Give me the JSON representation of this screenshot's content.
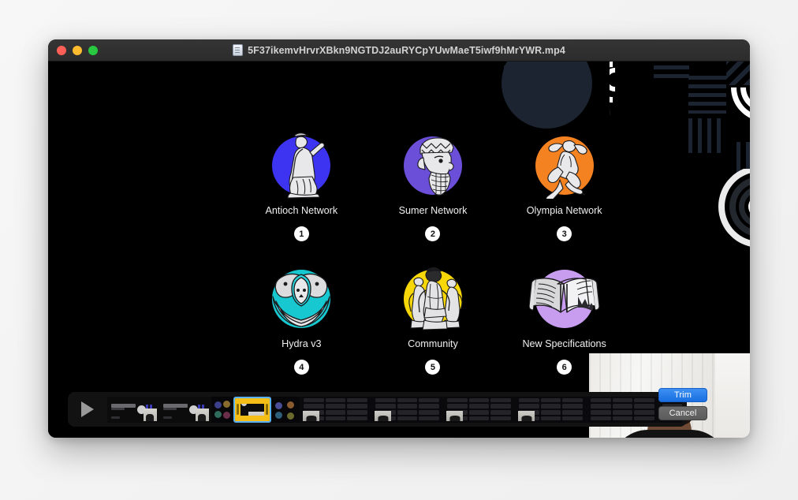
{
  "window": {
    "title": "5F37ikemvHrvrXBkn9NGTDJ2auRYCpYUwMaeT5iwf9hMrYWR.mp4",
    "doc_icon": "document-icon",
    "traffic_lights": [
      {
        "name": "close",
        "color": "#ff5f57"
      },
      {
        "name": "minimize",
        "color": "#febc2e"
      },
      {
        "name": "maximize",
        "color": "#28c840"
      }
    ]
  },
  "video_frame": {
    "background_color": "#000000",
    "apps": [
      {
        "label": "Antioch Network",
        "badge": "1",
        "blob_color": "#3d34f2",
        "icon": "roman-orator-statue-icon"
      },
      {
        "label": "Sumer Network",
        "badge": "2",
        "blob_color": "#6b4fd8",
        "icon": "sumerian-king-head-icon"
      },
      {
        "label": "Olympia Network",
        "badge": "3",
        "blob_color": "#f58220",
        "icon": "discus-thrower-icon"
      },
      {
        "label": "Hydra v3",
        "badge": "4",
        "blob_color": "#18c8d0",
        "icon": "hydra-shield-icon"
      },
      {
        "label": "Community",
        "badge": "5",
        "blob_color": "#f7d708",
        "icon": "greek-figures-group-icon"
      },
      {
        "label": "New Specifications",
        "badge": "6",
        "blob_color": "#c89df0",
        "icon": "open-book-icon"
      }
    ]
  },
  "webcam_overlay": {
    "name": "picture-in-picture-webcam",
    "description": "presenter in front of white curtains"
  },
  "controls": {
    "play_button_icon": "play-triangle-icon",
    "timeline_name": "video-timeline-scrubber",
    "trim_selection": {
      "name": "trim-range-selector",
      "handle_color": "#f5bf18",
      "focus_color": "#5ab0f0"
    },
    "trim_label": "Trim",
    "cancel_label": "Cancel",
    "trim_color": "#2d7ff0"
  }
}
